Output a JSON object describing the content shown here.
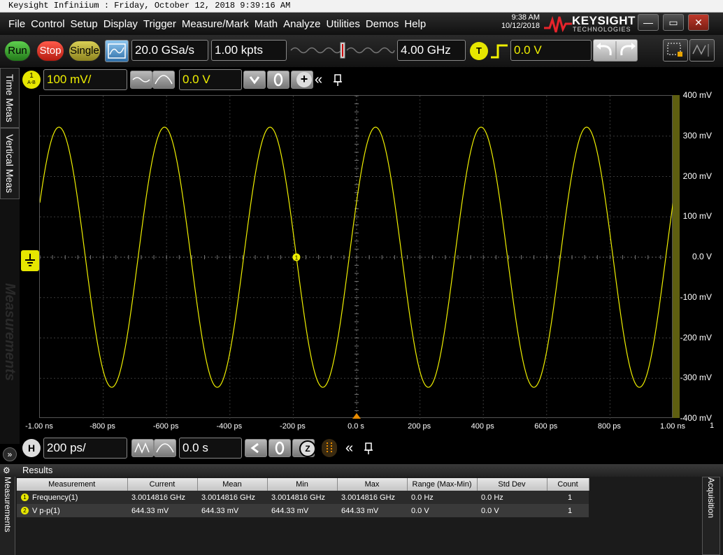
{
  "window_title": "Keysight Infiniium : Friday, October 12, 2018 9:39:16 AM",
  "menu": [
    "File",
    "Control",
    "Setup",
    "Display",
    "Trigger",
    "Measure/Mark",
    "Math",
    "Analyze",
    "Utilities",
    "Demos",
    "Help"
  ],
  "clock": {
    "time": "9:38 AM",
    "date": "10/12/2018"
  },
  "logo": {
    "brand": "KEYSIGHT",
    "sub": "TECHNOLOGIES"
  },
  "toolbar": {
    "run": "Run",
    "stop": "Stop",
    "single": "Single",
    "sample_rate": "20.0 GSa/s",
    "memory_depth": "1.00 kpts",
    "bandwidth": "4.00 GHz",
    "trigger_badge": "T",
    "trigger_level": "0.0 V"
  },
  "side_tabs": {
    "time_meas": "Time Meas",
    "vertical_meas": "Vertical Meas",
    "measurements": "Measurements"
  },
  "channel": {
    "badge": "1",
    "badge_sub": "A-B",
    "scale": "100 mV/",
    "offset": "0.0 V",
    "color": "#f0f000"
  },
  "horizontal": {
    "badge": "H",
    "scale": "200 ps/",
    "position": "0.0 s",
    "zoom": "Z"
  },
  "y_axis": {
    "labels": [
      "400 mV",
      "300 mV",
      "200 mV",
      "100 mV",
      "0.0 V",
      "-100 mV",
      "-200 mV",
      "-300 mV",
      "-400 mV"
    ]
  },
  "x_axis": {
    "labels": [
      "-1.00 ns",
      "-800 ps",
      "-600 ps",
      "-400 ps",
      "-200 ps",
      "0.0 s",
      "200 ps",
      "400 ps",
      "600 ps",
      "800 ps",
      "1.00 ns"
    ]
  },
  "x_axis_extra": "1",
  "waveform": {
    "frequency_ghz": 3.0014816,
    "amplitude_mv": 322.2,
    "marker_label": "1"
  },
  "results": {
    "title": "Results",
    "right_tab": "Acquisition",
    "columns": [
      "Measurement",
      "Current",
      "Mean",
      "Min",
      "Max",
      "Range (Max-Min)",
      "Std Dev",
      "Count"
    ],
    "rows": [
      {
        "num": "1",
        "cells": [
          "Frequency(1)",
          "3.0014816 GHz",
          "3.0014816 GHz",
          "3.0014816 GHz",
          "3.0014816 GHz",
          "0.0 Hz",
          "0.0 Hz",
          "1"
        ]
      },
      {
        "num": "2",
        "cells": [
          "V p-p(1)",
          "644.33 mV",
          "644.33 mV",
          "644.33 mV",
          "644.33 mV",
          "0.0 V",
          "0.0 V",
          "1"
        ]
      }
    ]
  }
}
